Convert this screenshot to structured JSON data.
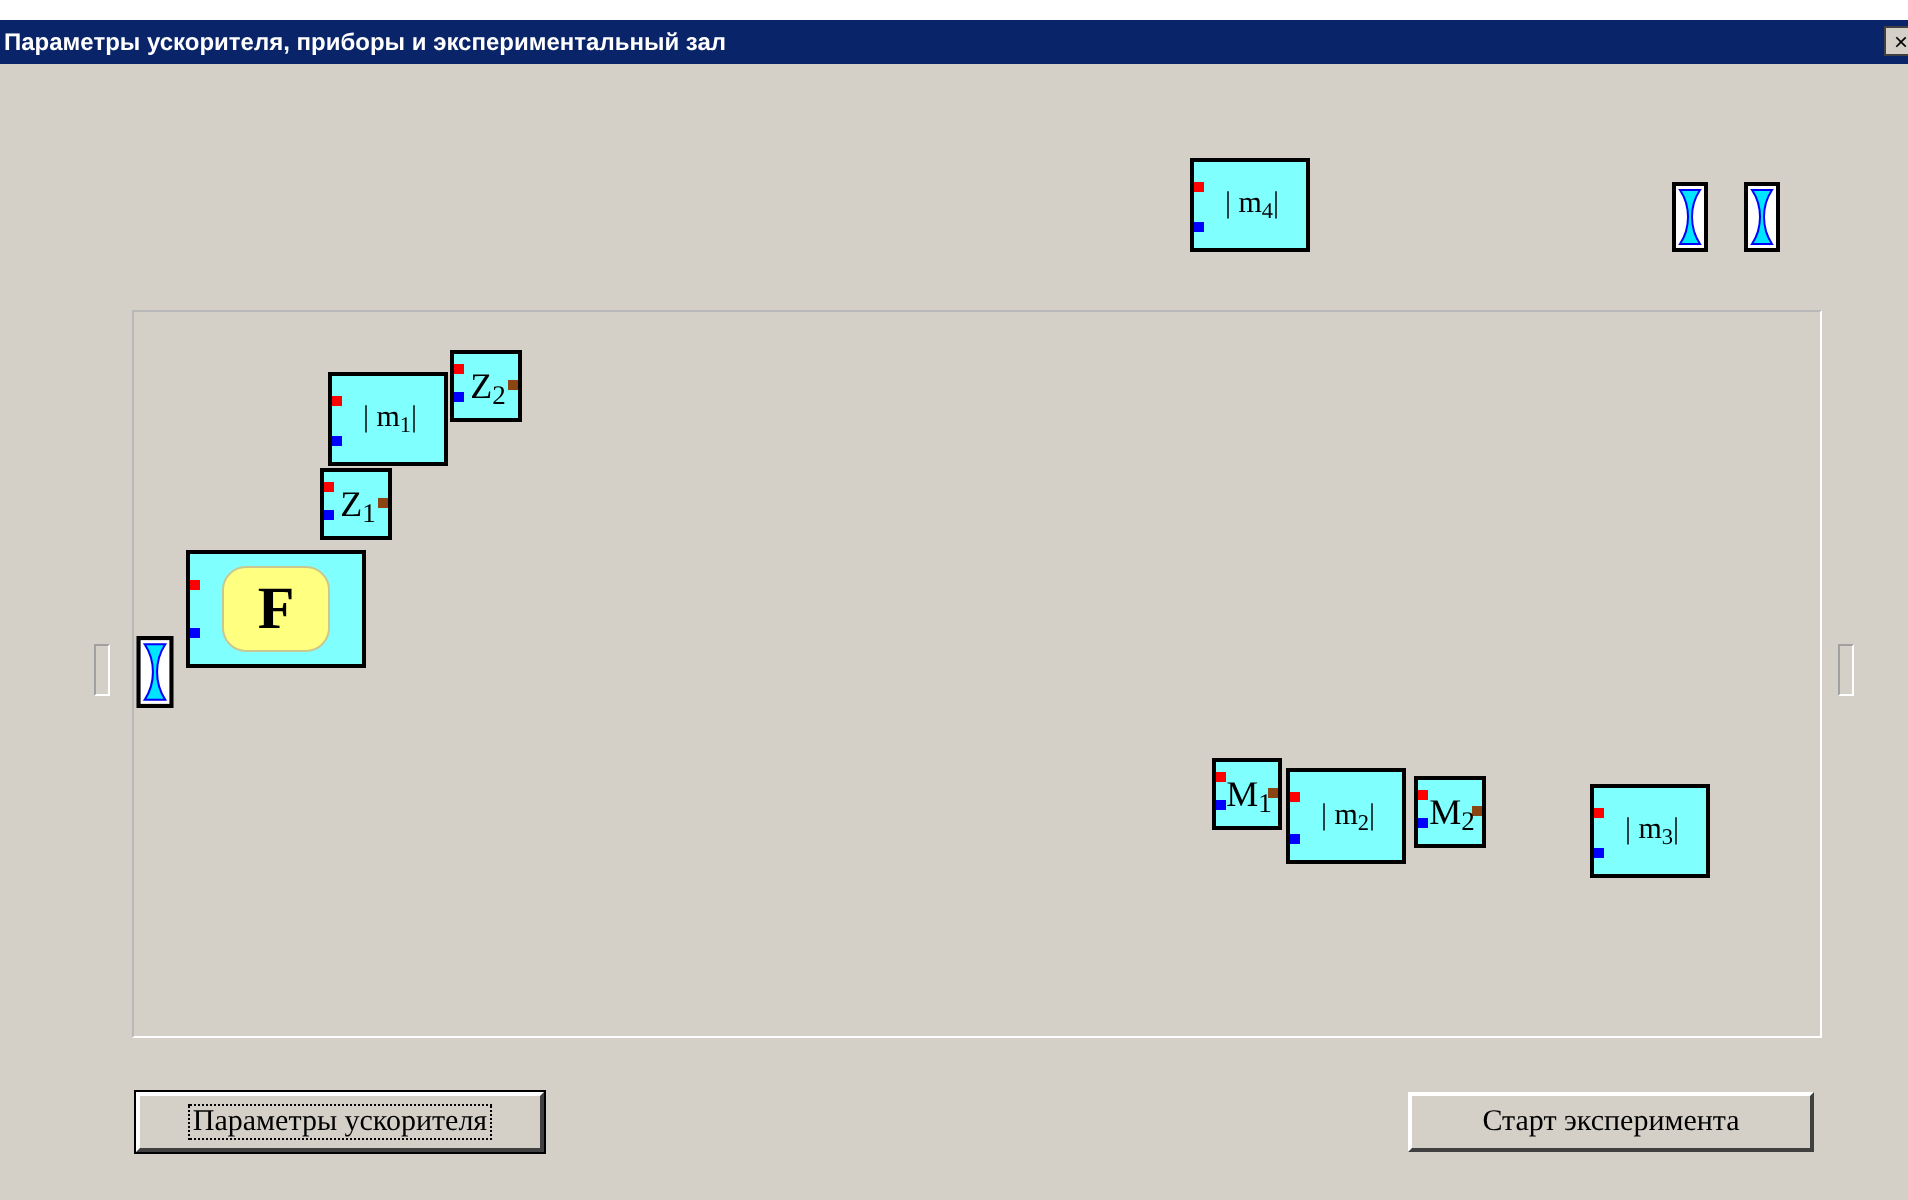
{
  "window": {
    "title": "Параметры ускорителя, приборы и экспериментальный зал",
    "close": "×"
  },
  "blocks": [
    {
      "kind": "detector",
      "label": "| m$_{4}$|"
    },
    {
      "kind": "lens"
    },
    {
      "kind": "lens"
    },
    {
      "kind": "detector",
      "label": "| m$_{1}$|"
    },
    {
      "kind": "element",
      "label": "Z$_{2}$"
    },
    {
      "kind": "element",
      "label": "Z$_{1}$"
    },
    {
      "kind": "source",
      "label": "F"
    },
    {
      "kind": "lens"
    },
    {
      "kind": "element",
      "label": "M$_{1}$"
    },
    {
      "kind": "detector",
      "label": "| m$_{2}$|"
    },
    {
      "kind": "element",
      "label": "M$_{2}$"
    },
    {
      "kind": "detector",
      "label": "| m$_{3}$|"
    }
  ],
  "buttons": [
    {
      "label": "Параметры ускорителя",
      "focused": true
    },
    {
      "label": "Старт эксперимента",
      "focused": false
    }
  ]
}
